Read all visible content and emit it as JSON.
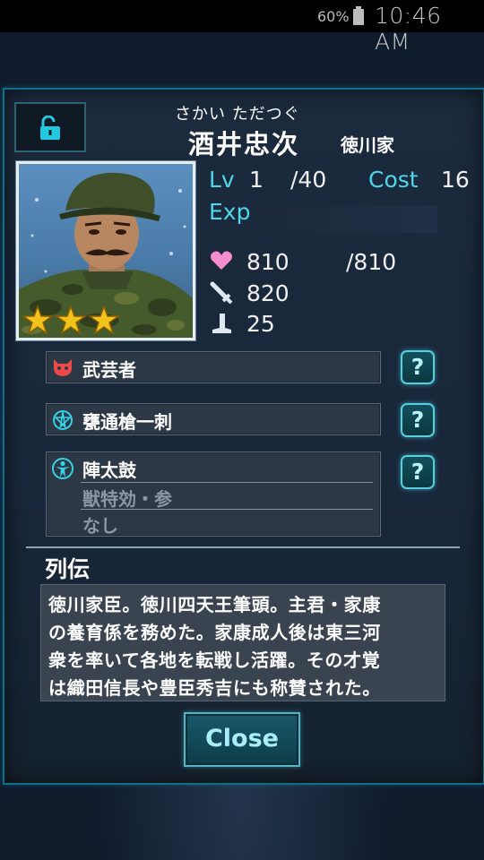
{
  "status_bar": {
    "battery": "60%",
    "time": "10:46 AM"
  },
  "character": {
    "reading": "さかい ただつぐ",
    "name": "酒井忠次",
    "clan": "徳川家",
    "stars": 3
  },
  "stats": {
    "lv_label": "Lv",
    "lv": "1",
    "lv_max": "/40",
    "cost_label": "Cost",
    "cost": "16",
    "exp_label": "Exp",
    "hp": "810",
    "hp_max": "/810",
    "attack": "820",
    "speed": "25"
  },
  "skills": [
    {
      "label": "武芸者",
      "icon": "oni-mask-icon",
      "help": "?"
    },
    {
      "label": "甕通槍一刺",
      "icon": "pentagram-icon",
      "help": "?"
    },
    {
      "label": "陣太鼓",
      "icon": "figure-icon",
      "help": "?",
      "sub1": "獣特効・参",
      "sub2": "なし"
    }
  ],
  "bio": {
    "title": "列伝",
    "lines": [
      "徳川家臣。徳川四天王筆頭。主君・家康",
      "の養育係を務めた。家康成人後は東三河",
      "衆を率いて各地を転戦し活躍。その才覚",
      "は織田信長や豊臣秀吉にも称賛された。"
    ]
  },
  "close_label": "Close",
  "colors": {
    "accent": "#4fd6e8",
    "panel_border": "#0f6f86",
    "star": "#f2c31d"
  }
}
